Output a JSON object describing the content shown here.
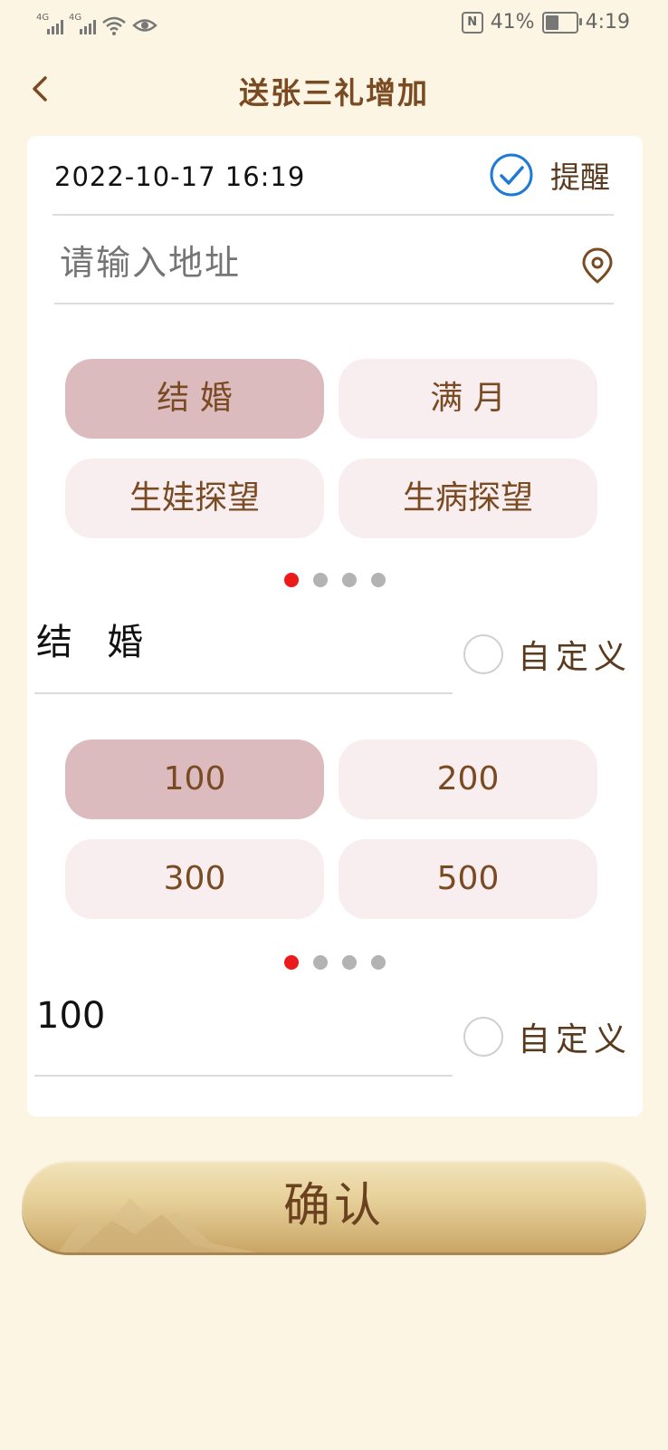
{
  "status": {
    "battery": "41%",
    "time": "4:19",
    "network_tag": "4G"
  },
  "header": {
    "title": "送张三礼增加"
  },
  "form": {
    "datetime": "2022-10-17  16:19",
    "remind_label": "提醒",
    "address_placeholder": "请输入地址",
    "occasions": [
      "结 婚",
      "满 月",
      "生娃探望",
      "生病探望"
    ],
    "occasion_value": "结   婚",
    "amounts": [
      "100",
      "200",
      "300",
      "500"
    ],
    "amount_value": "100",
    "custom_label": "自定义"
  },
  "confirm_label": "确认",
  "colors": {
    "accent_red": "#ec1b1b",
    "check_blue": "#1f7ad6",
    "brown": "#7a4a22"
  }
}
